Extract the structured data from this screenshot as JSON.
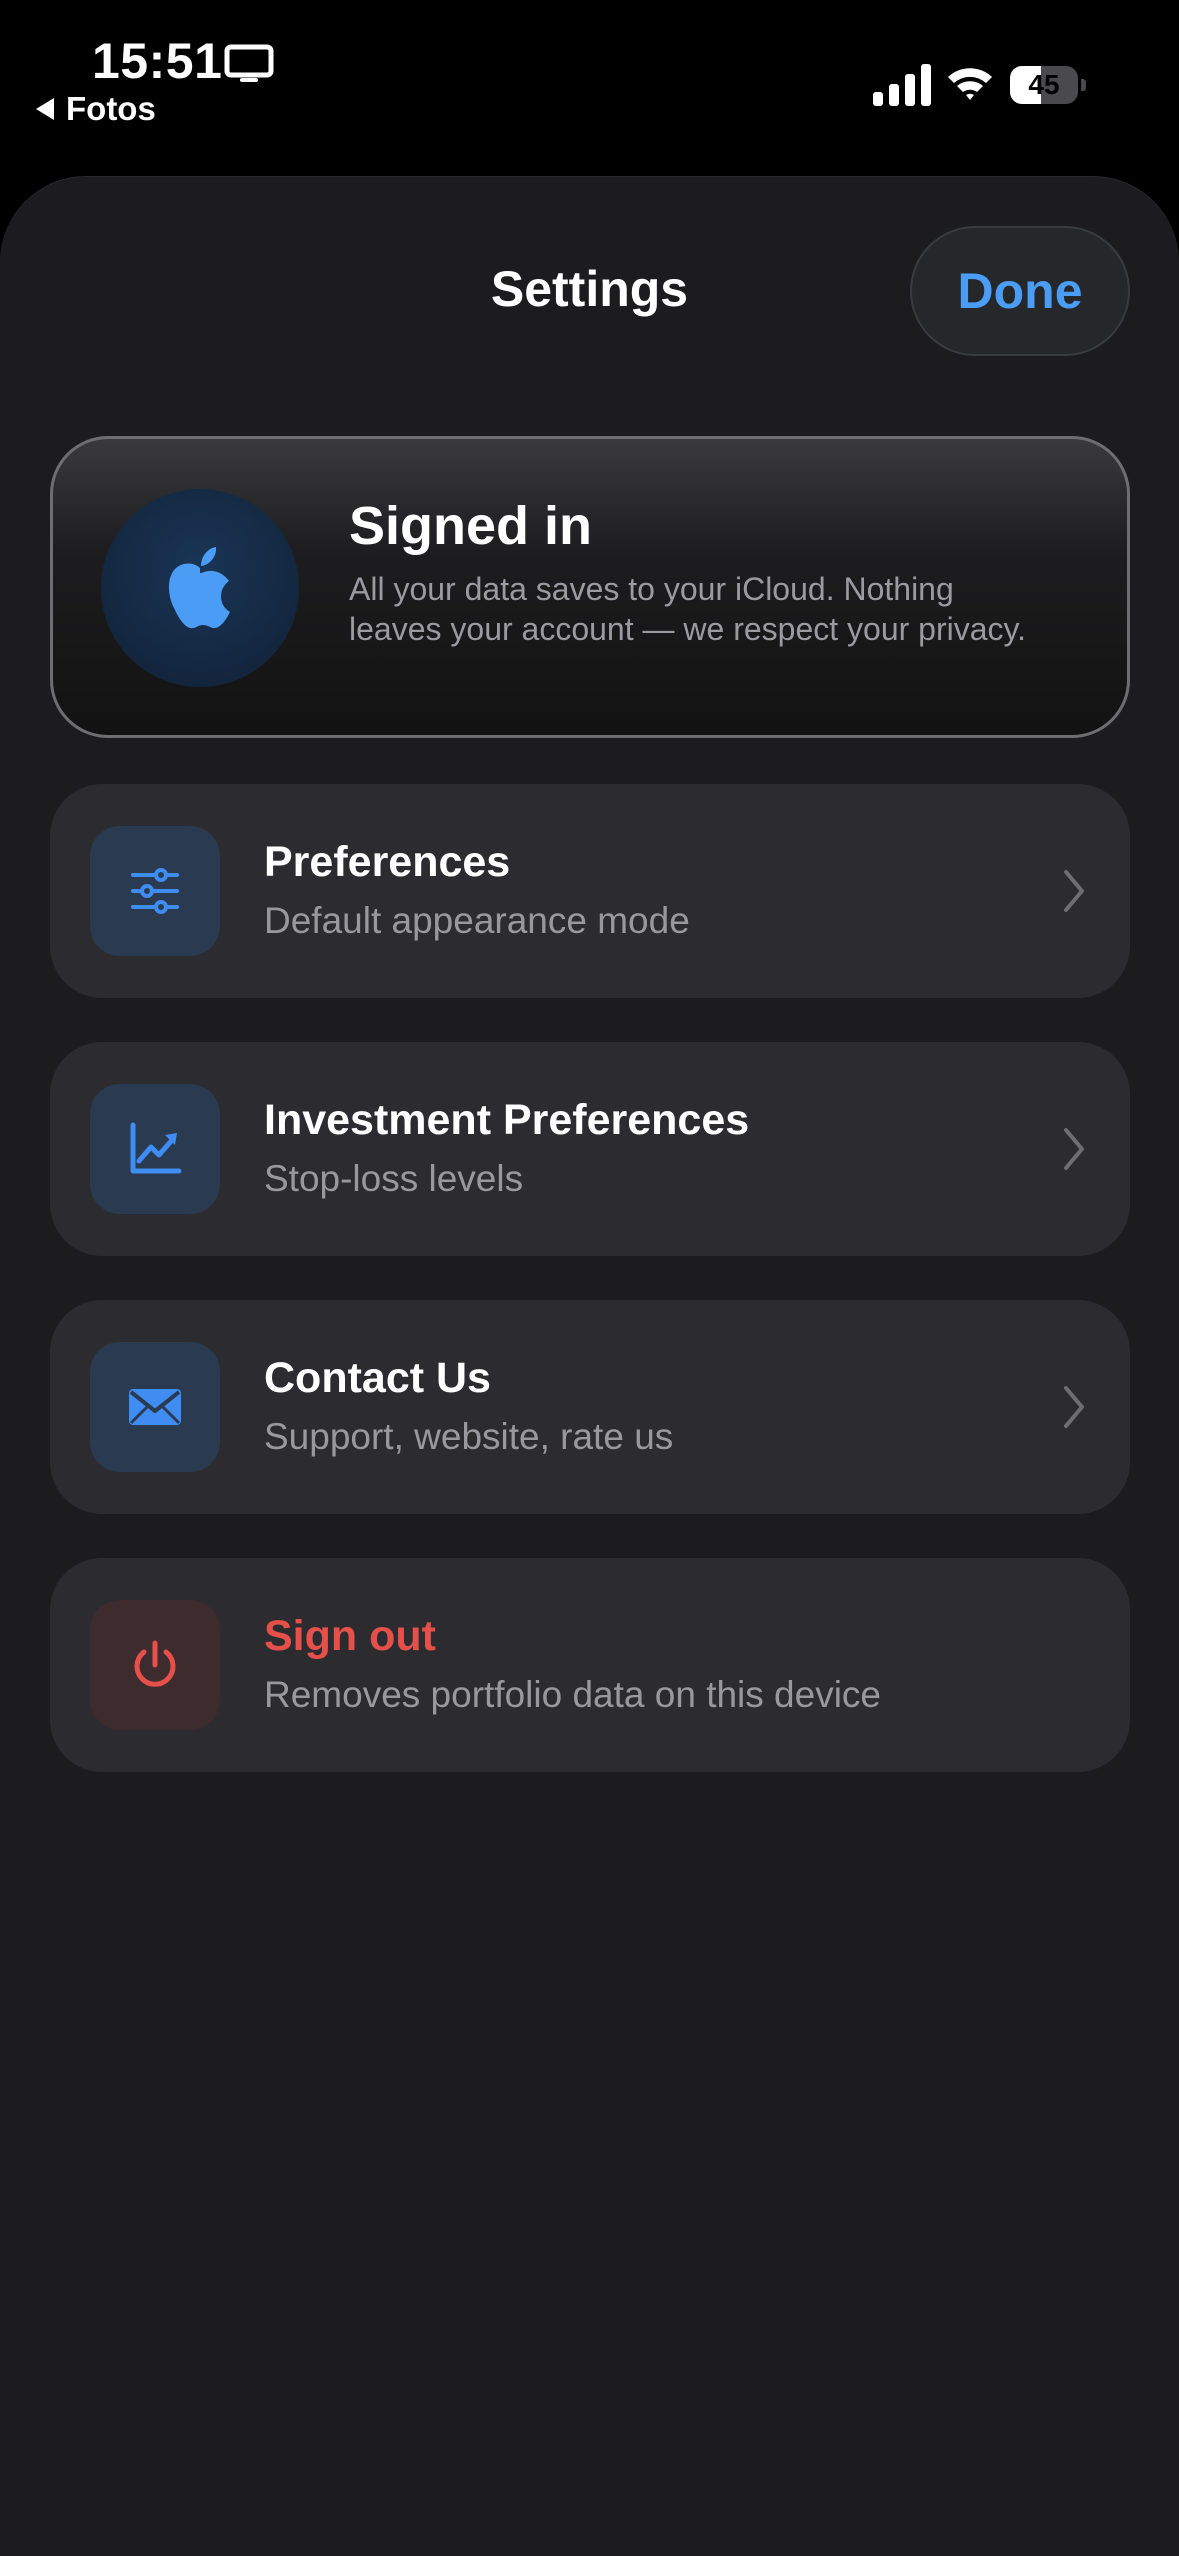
{
  "status_bar": {
    "time": "15:51",
    "back_app_label": "Fotos",
    "battery_percent": "45",
    "battery_level": 0.45,
    "screen_mirror_icon": "tv-icon",
    "signal_icon": "cellular-signal-icon",
    "wifi_icon": "wifi-icon"
  },
  "sheet": {
    "title": "Settings",
    "done_label": "Done"
  },
  "account": {
    "title": "Signed in",
    "description": "All your data saves to your iCloud. Nothing leaves your account — we respect your privacy.",
    "icon": "apple-logo-icon"
  },
  "rows": [
    {
      "title": "Preferences",
      "subtitle": "Default appearance mode",
      "icon": "sliders-icon"
    },
    {
      "title": "Investment Preferences",
      "subtitle": "Stop-loss levels",
      "icon": "chart-trend-up-icon"
    },
    {
      "title": "Contact Us",
      "subtitle": "Support, website, rate us",
      "icon": "envelope-icon"
    },
    {
      "title": "Sign out",
      "subtitle": "Removes portfolio data on this device",
      "icon": "power-icon"
    }
  ],
  "colors": {
    "accent_blue": "#4a9cf5",
    "icon_blue": "#3f8cf2",
    "destructive_red": "#e5504a",
    "background": "#1c1c1e",
    "row_background": "#2c2c30",
    "secondary_text": "#98989e"
  }
}
